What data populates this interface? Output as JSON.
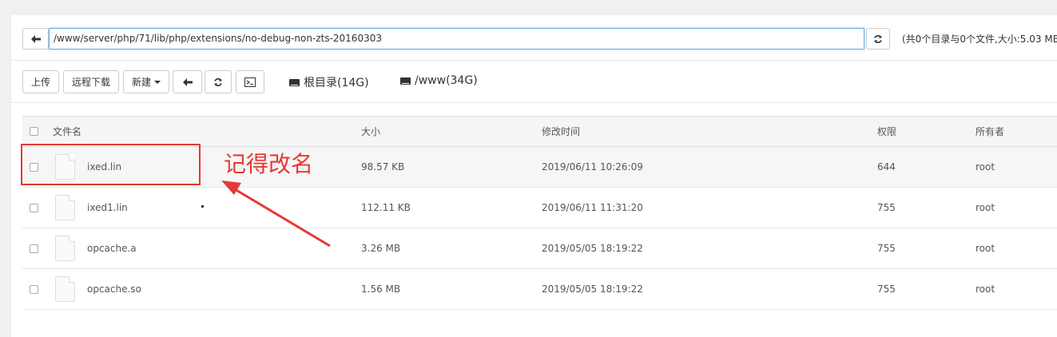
{
  "path_bar": {
    "path_value": "/www/server/php/71/lib/php/extensions/no-debug-non-zts-20160303",
    "summary": "(共0个目录与0个文件,大小:5.03 MB"
  },
  "toolbar": {
    "upload_label": "上传",
    "remote_download_label": "远程下载",
    "new_label": "新建",
    "disks": [
      {
        "label": "根目录(14G)"
      },
      {
        "label": "/www(34G)"
      }
    ]
  },
  "table": {
    "columns": [
      "文件名",
      "大小",
      "修改时间",
      "权限",
      "所有者"
    ],
    "rows": [
      {
        "name": "ixed.lin",
        "size": "98.57 KB",
        "modified": "2019/06/11 10:26:09",
        "permission": "644",
        "owner": "root"
      },
      {
        "name": "ixed1.lin",
        "size": "112.11 KB",
        "modified": "2019/06/11 11:31:20",
        "permission": "755",
        "owner": "root"
      },
      {
        "name": "opcache.a",
        "size": "3.26 MB",
        "modified": "2019/05/05 18:19:22",
        "permission": "755",
        "owner": "root"
      },
      {
        "name": "opcache.so",
        "size": "1.56 MB",
        "modified": "2019/05/05 18:19:22",
        "permission": "755",
        "owner": "root"
      }
    ]
  },
  "annotation": {
    "note": "记得改名",
    "color": "#e53935"
  },
  "icons": {
    "back": "arrow-left-icon",
    "refresh": "refresh-icon",
    "terminal": "terminal-icon",
    "disk": "hdd-icon",
    "file": "file-icon"
  }
}
